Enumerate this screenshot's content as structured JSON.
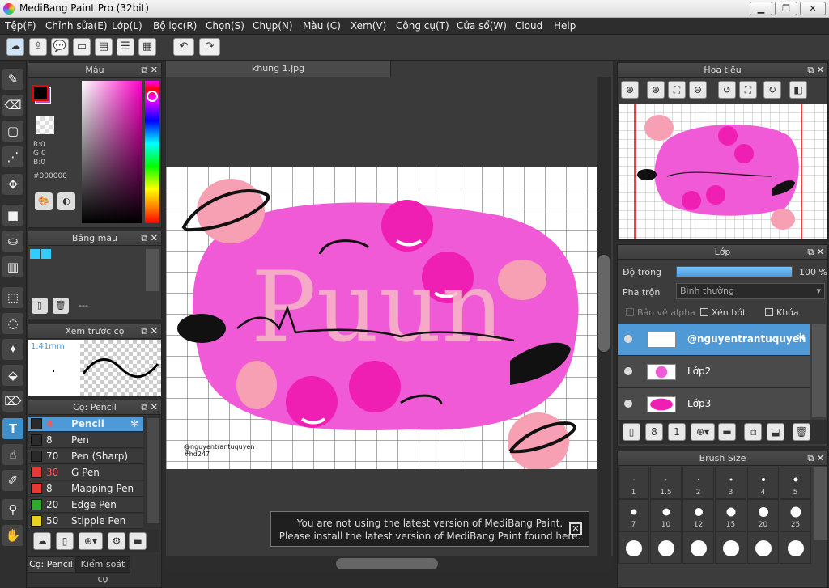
{
  "window": {
    "title": "MediBang Paint Pro (32bit)"
  },
  "menu": [
    "Tệp(F)",
    "Chỉnh sửa(E)",
    "Lớp(L)",
    "Bộ lọc(R)",
    "Chọn(S)",
    "Chụp(N)",
    "Màu (C)",
    "Xem(V)",
    "Công cụ(T)",
    "Cửa sổ(W)",
    "Cloud",
    "Help"
  ],
  "canvas": {
    "tab": "khung 1.jpg",
    "credit_line1": "@nguyentrantuquyen",
    "credit_line2": "#hd247"
  },
  "color_panel": {
    "title": "Màu",
    "r": "R:0",
    "g": "G:0",
    "b": "B:0",
    "hex": "#000000"
  },
  "palette_panel": {
    "title": "Bảng màu",
    "value": "---"
  },
  "brush_preview": {
    "title": "Xem trước cọ",
    "size": "1.41mm"
  },
  "brush_panel": {
    "title": "Cọ: Pencil",
    "items": [
      {
        "size": "4",
        "name": "Pencil",
        "color": "#2a2a2a"
      },
      {
        "size": "8",
        "name": "Pen",
        "color": "#2a2a2a"
      },
      {
        "size": "70",
        "name": "Pen (Sharp)",
        "color": "#2a2a2a"
      },
      {
        "size": "30",
        "name": "G Pen",
        "color": "#e53935"
      },
      {
        "size": "8",
        "name": "Mapping Pen",
        "color": "#e53935"
      },
      {
        "size": "20",
        "name": "Edge Pen",
        "color": "#2ea82e"
      },
      {
        "size": "50",
        "name": "Stipple Pen",
        "color": "#e6d21f"
      }
    ],
    "tabs": [
      "Cọ: Pencil",
      "Kiểm soát cọ"
    ]
  },
  "navigator": {
    "title": "Hoa tiêu"
  },
  "layer_panel": {
    "title": "Lớp",
    "opacity_label": "Độ trong",
    "opacity_value": "100 %",
    "blend_label": "Pha trộn",
    "blend_value": "Bình thường",
    "protect_alpha": "Bảo vệ alpha",
    "clip": "Xén bớt",
    "lock": "Khóa",
    "layers": [
      "@nguyentrantuquyen",
      "Lớp2",
      "Lớp3"
    ]
  },
  "brush_size": {
    "title": "Brush Size",
    "sizes": [
      "1",
      "1.5",
      "2",
      "3",
      "4",
      "5",
      "7",
      "10",
      "12",
      "15",
      "20",
      "25",
      "",
      "",
      "",
      "",
      "",
      ""
    ]
  },
  "notice": {
    "line1": "You are not using the latest version of MediBang Paint.",
    "line2": "Please install the latest version of MediBang Paint found here."
  },
  "colors": {
    "accent": "#4f9ad6",
    "pink": "#f05ad6",
    "hotpink": "#f01fb4"
  }
}
